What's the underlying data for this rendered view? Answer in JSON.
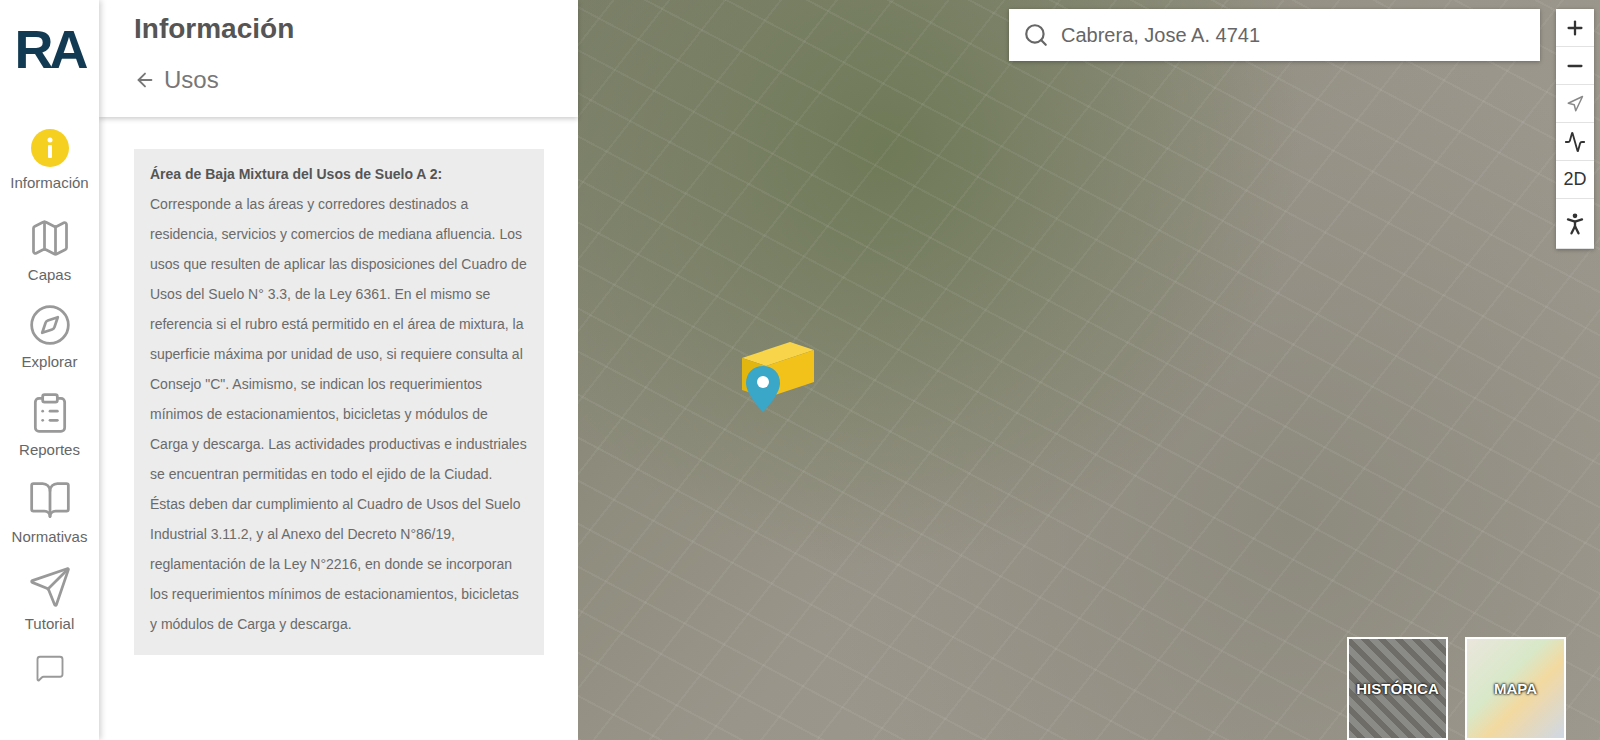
{
  "logo": {
    "text": "RA"
  },
  "sidebar": {
    "items": [
      {
        "label": "Información",
        "selected": true
      },
      {
        "label": "Capas",
        "selected": false
      },
      {
        "label": "Explorar",
        "selected": false
      },
      {
        "label": "Reportes",
        "selected": false
      },
      {
        "label": "Normativas",
        "selected": false
      },
      {
        "label": "Tutorial",
        "selected": false
      }
    ]
  },
  "panel": {
    "title": "Información",
    "back": {
      "label": "Usos"
    },
    "description": {
      "title": "Área de Baja Mixtura del Usos de Suelo A 2:",
      "body": "Corresponde a las áreas y corredores destinados a residencia, servicios y comercios de mediana afluencia. Los usos que resulten de aplicar las disposiciones del Cuadro de Usos del Suelo N° 3.3, de la Ley 6361. En el mismo se referencia si el rubro está permitido en el área de mixtura, la superficie máxima por unidad de uso, si requiere consulta al Consejo \"C\". Asimismo, se indican los requerimientos mínimos de estacionamientos, bicicletas y módulos de Carga y descarga. Las actividades productivas e industriales se encuentran permitidas en todo el ejido de la Ciudad. Éstas deben dar cumplimiento al Cuadro de Usos del Suelo Industrial 3.11.2, y al Anexo del Decreto N°86/19, reglamentación de la Ley N°2216, en donde se incorporan los requerimientos mínimos de estacionamientos, bicicletas y módulos de Carga y descarga."
    }
  },
  "search": {
    "value": "Cabrera, Jose A. 4741"
  },
  "map_controls": {
    "mode": "2D"
  },
  "base_layers": [
    {
      "label": "HISTÓRICA",
      "selected": false
    },
    {
      "label": "MAPA",
      "selected": false
    }
  ]
}
